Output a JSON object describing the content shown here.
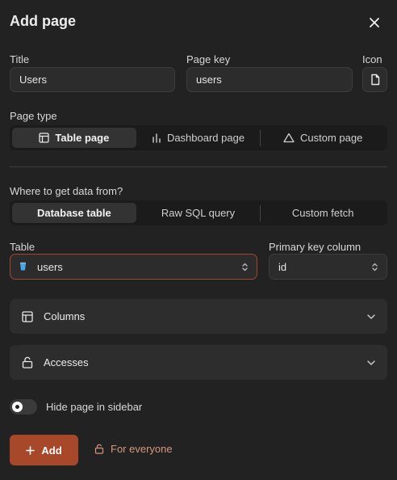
{
  "dialog": {
    "title": "Add page"
  },
  "fields": {
    "title_label": "Title",
    "title_value": "Users",
    "page_key_label": "Page key",
    "page_key_value": "users",
    "icon_label": "Icon"
  },
  "page_type": {
    "label": "Page type",
    "options": [
      "Table page",
      "Dashboard page",
      "Custom page"
    ],
    "selected": "Table page"
  },
  "data_source": {
    "label": "Where to get data from?",
    "options": [
      "Database table",
      "Raw SQL query",
      "Custom fetch"
    ],
    "selected": "Database table"
  },
  "table": {
    "label": "Table",
    "value": "users",
    "pk_label": "Primary key column",
    "pk_value": "id"
  },
  "sections": {
    "columns": "Columns",
    "accesses": "Accesses"
  },
  "sidebar_toggle": {
    "label": "Hide page in sidebar",
    "on": false
  },
  "footer": {
    "add_label": "Add",
    "access_label": "For everyone"
  },
  "colors": {
    "accent": "#a8482a",
    "accent_text": "#d7967b",
    "background": "#222222"
  }
}
